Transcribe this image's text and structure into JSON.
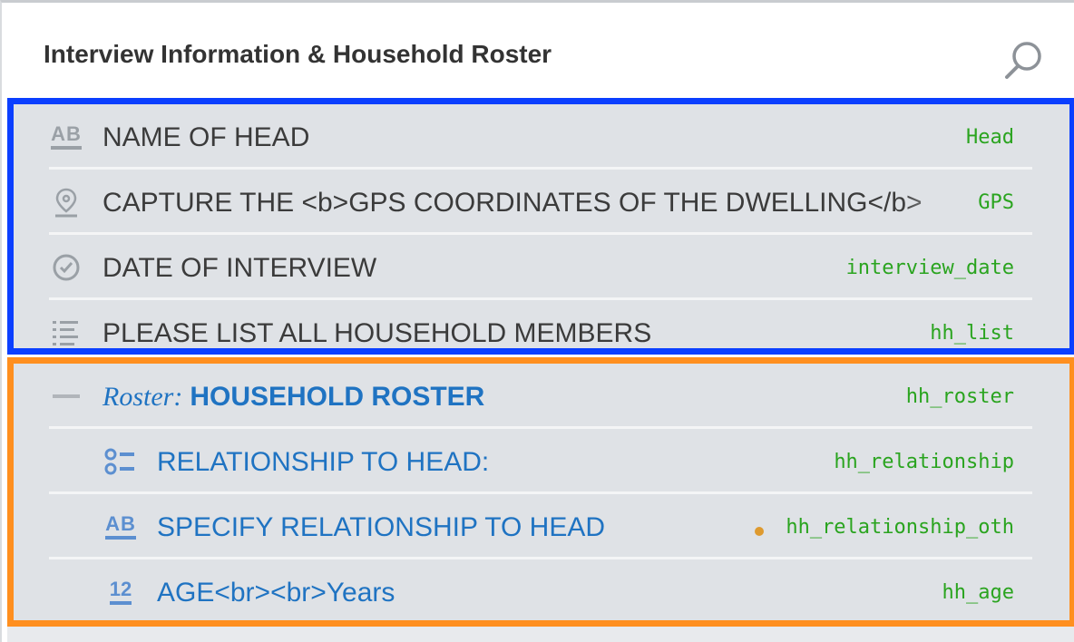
{
  "header": {
    "title": "Interview Information & Household Roster"
  },
  "colors": {
    "panel_bg": "#dfe2e6",
    "highlight_blue": "#0b3fff",
    "highlight_orange": "#ff8f1f",
    "variable_green": "#2aa41f",
    "roster_blue": "#1f73c2",
    "warning_dot": "#de9a2f"
  },
  "questions": [
    {
      "icon": "text-question-icon",
      "text": "NAME OF HEAD",
      "variable": "Head"
    },
    {
      "icon": "gps-pin-icon",
      "text": "CAPTURE THE <b>GPS COORDINATES OF THE DWELLING</b>",
      "variable": "GPS"
    },
    {
      "icon": "clock-icon",
      "text": "DATE OF INTERVIEW",
      "variable": "interview_date"
    },
    {
      "icon": "list-icon",
      "text": "PLEASE LIST ALL HOUSEHOLD MEMBERS",
      "variable": "hh_list"
    }
  ],
  "roster": {
    "icon": "collapse-minus-icon",
    "kind": "Roster:",
    "name": "HOUSEHOLD ROSTER",
    "variable": "hh_roster",
    "children": [
      {
        "icon": "single-select-icon",
        "text": "RELATIONSHIP TO HEAD:",
        "variable": "hh_relationship",
        "has_indicator": false
      },
      {
        "icon": "text-question-icon",
        "text": "SPECIFY RELATIONSHIP TO HEAD",
        "variable": "hh_relationship_oth",
        "has_indicator": true
      },
      {
        "icon": "numeric-question-icon",
        "text": "AGE<br><br>Years",
        "variable": "hh_age",
        "has_indicator": false
      }
    ]
  }
}
